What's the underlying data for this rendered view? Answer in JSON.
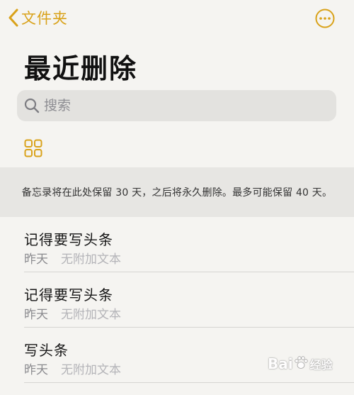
{
  "nav": {
    "back_label": "文件夹"
  },
  "page": {
    "title": "最近删除"
  },
  "search": {
    "placeholder": "搜索"
  },
  "banner": {
    "text": "备忘录将在此处保留 30 天，之后将永久删除。最多可能保留 40 天。"
  },
  "notes": [
    {
      "title": "记得要写头条",
      "date": "昨天",
      "preview": "无附加文本"
    },
    {
      "title": "记得要写头条",
      "date": "昨天",
      "preview": "无附加文本"
    },
    {
      "title": "写头条",
      "date": "昨天",
      "preview": "无附加文本"
    }
  ],
  "watermark": {
    "brand": "Bai",
    "suffix": "经验"
  },
  "colors": {
    "accent": "#d9a21a",
    "background": "#f5f4f1",
    "search_bg": "#e3e2df",
    "banner_bg": "#e7e6e3"
  },
  "icons": {
    "back": "chevron-left-icon",
    "more": "ellipsis-circle-icon",
    "search": "magnifier-icon",
    "gallery": "grid-icon"
  }
}
